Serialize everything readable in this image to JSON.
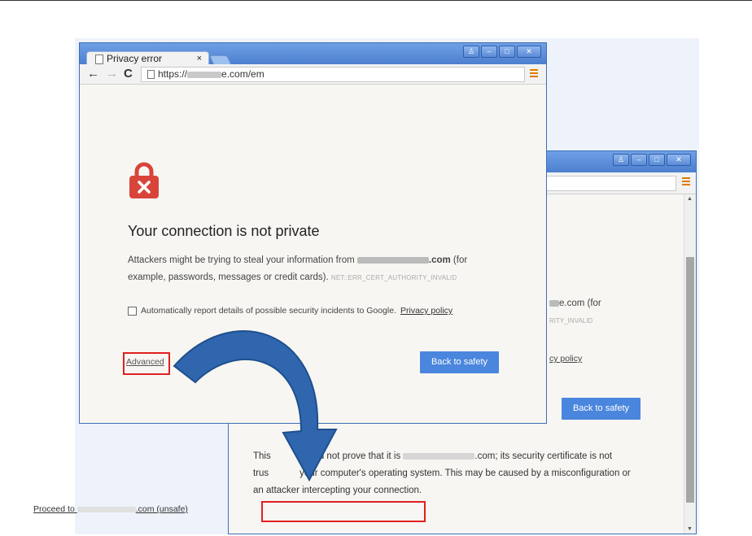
{
  "front_window": {
    "tab_title": "Privacy error",
    "tab_close": "×",
    "nav": {
      "back": "←",
      "forward": "→",
      "reload": "C"
    },
    "url_prefix": "https://",
    "url_suffix": "e.com/em",
    "heading": "Your connection is not private",
    "body_part1": "Attackers might be trying to steal your information from",
    "body_domain_suffix": ".com",
    "body_part2": "(for example, passwords, messages or credit cards).",
    "error_code": "NET::ERR_CERT_AUTHORITY_INVALID",
    "checkbox_label": "Automatically report details of possible security incidents to Google.",
    "privacy_link": "Privacy policy",
    "advanced_link": "Advanced",
    "back_to_safety": "Back to safety"
  },
  "back_window": {
    "partial_domain": "e.com (for",
    "partial_error": "RITY_INVALID",
    "partial_privacy": "cy policy",
    "back_to_safety": "Back to safety",
    "para_line1_a": "This",
    "para_line1_b": "could not prove that it is",
    "para_line1_c": ".com; its security certificate is not",
    "para_line2_a": "trus",
    "para_line2_b": "your computer's operating system. This may be caused by a misconfiguration or",
    "para_line3": "an attacker intercepting your connection.",
    "proceed_a": "Proceed to",
    "proceed_b": ".com (unsafe)"
  },
  "colors": {
    "accent_blue": "#4a86dd",
    "highlight_red": "#e02020",
    "lock_red": "#d9443a",
    "arrow_blue": "#2f66ad"
  }
}
